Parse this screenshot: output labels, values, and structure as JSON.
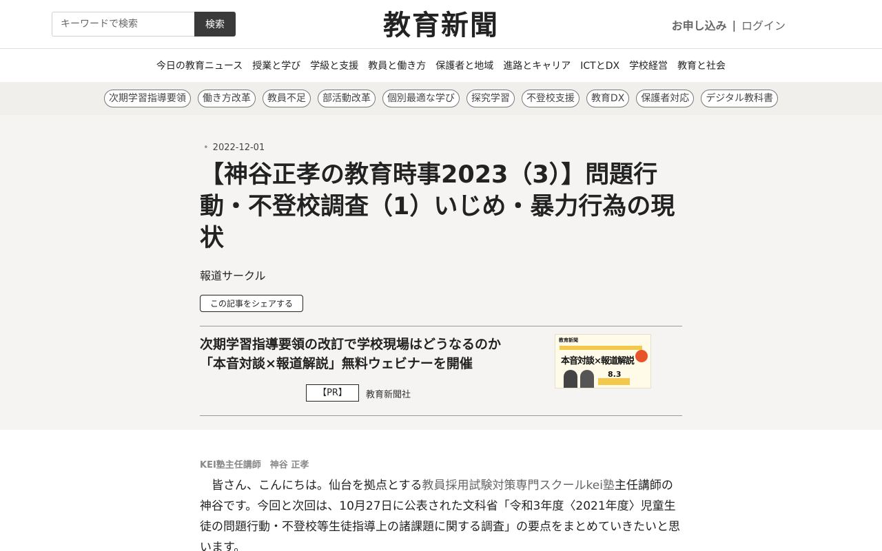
{
  "header": {
    "search_placeholder": "キーワードで検索",
    "search_button": "検索",
    "logo": "教育新聞",
    "apply_label": "お申し込み",
    "separator": "|",
    "login_label": "ログイン"
  },
  "nav": {
    "items": [
      "今日の教育ニュース",
      "授業と学び",
      "学級と支援",
      "教員と働き方",
      "保護者と地域",
      "進路とキャリア",
      "ICTとDX",
      "学校経営",
      "教育と社会"
    ]
  },
  "tags": [
    "次期学習指導要領",
    "働き方改革",
    "教員不足",
    "部活動改革",
    "個別最適な学び",
    "探究学習",
    "不登校支援",
    "教育DX",
    "保護者対応",
    "デジタル教科書"
  ],
  "article": {
    "date": "2022-12-01",
    "title": "【神谷正孝の教育時事2023（3）】問題行動・不登校調査（1）いじめ・暴力行為の現状",
    "author": "報道サークル",
    "share_label": "この記事をシェアする"
  },
  "pr": {
    "title": "次期学習指導要領の改訂で学校現場はどうなるのか 「本音対談×報道解説」無料ウェビナーを開催",
    "badge": "【PR】",
    "company": "教育新聞社",
    "thumb_logo": "教育新聞",
    "thumb_heading": "本音対談×報道解説",
    "thumb_date": "8.3"
  },
  "body": {
    "byline": "KEI塾主任講師　神谷 正孝",
    "p1_before": "　皆さん、こんにちは。仙台を拠点とする",
    "p1_link": "教員採用試験対策専門スクールkei塾",
    "p1_after": "主任講師の神谷です。今回と次回は、10月27日に公表された文科省「令和3年度〈2021年度〉児童生徒の問題行動・不登校等生徒指導上の諸課題に関する調査」の要点をまとめていきたいと思います。"
  }
}
